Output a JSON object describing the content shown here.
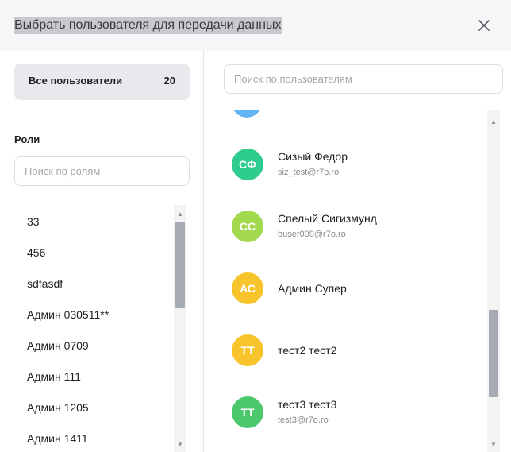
{
  "dialog": {
    "title": "Выбрать пользователя для передачи данных",
    "close_icon": "close-icon"
  },
  "sidebar": {
    "all_users_label": "Все пользователи",
    "all_users_count": "20",
    "roles_title": "Роли",
    "roles_search_placeholder": "Поиск по ролям",
    "roles": [
      {
        "label": "33"
      },
      {
        "label": "456"
      },
      {
        "label": "sdfasdf"
      },
      {
        "label": "Админ 030511**"
      },
      {
        "label": "Админ 0709"
      },
      {
        "label": "Админ 111"
      },
      {
        "label": "Админ 1205"
      },
      {
        "label": "Админ 1411"
      }
    ]
  },
  "main": {
    "users_search_placeholder": "Поиск по пользователям",
    "users": [
      {
        "initials": "СФ",
        "name": "Сизый Федор",
        "email": "siz_test@r7o.ro",
        "color": "#2ecc8f"
      },
      {
        "initials": "СС",
        "name": "Спелый Сигизмунд",
        "email": "buser009@r7o.ro",
        "color": "#a3d94f"
      },
      {
        "initials": "АС",
        "name": "Админ Супер",
        "email": "",
        "color": "#f7c52b"
      },
      {
        "initials": "ТТ",
        "name": "тест2 тест2",
        "email": "",
        "color": "#f7c52b"
      },
      {
        "initials": "ТТ",
        "name": "тест3 тест3",
        "email": "test3@r7o.ro",
        "color": "#4cc76b"
      }
    ]
  },
  "colors": {
    "header_bg": "#f5f6f8",
    "selected_bg": "#e8e9ec",
    "scrollbar_thumb": "#a6abb3"
  }
}
